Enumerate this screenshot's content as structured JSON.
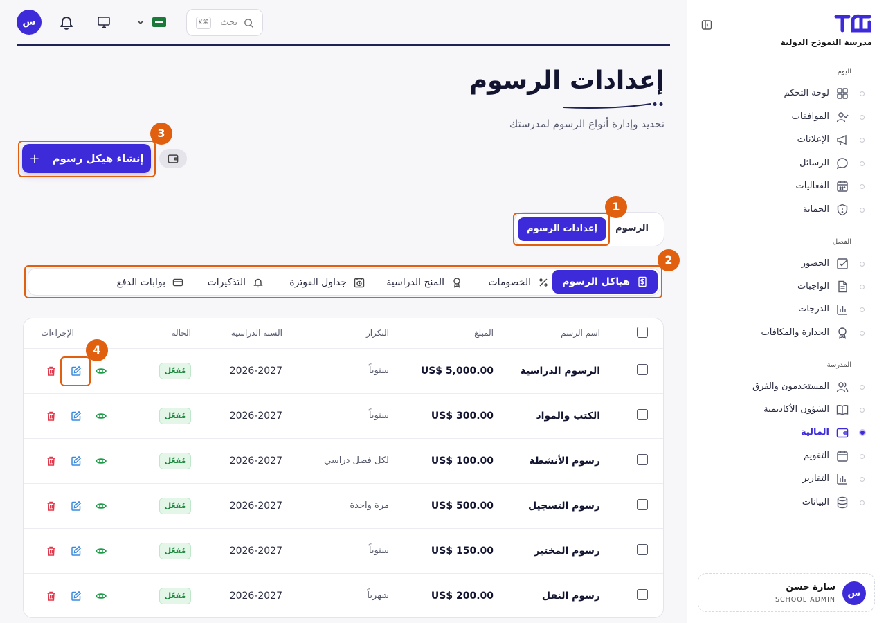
{
  "app": {
    "school_name": "مدرسة النموذج الدولية",
    "accent_color": "#3d2ad9",
    "annotation_color": "#e1600f"
  },
  "topbar": {
    "avatar_initial": "س",
    "search_placeholder": "بحث",
    "search_shortcut": "K⌘",
    "language_flag": "saudi-flag",
    "icons": [
      "bell-icon",
      "monitor-icon",
      "chevron-down-icon",
      "search-icon"
    ]
  },
  "sidebar": {
    "sections": [
      {
        "label": "اليوم",
        "items": [
          {
            "label": "لوحة التحكم",
            "icon": "dashboard-icon"
          },
          {
            "label": "الموافقات",
            "icon": "user-check-icon"
          },
          {
            "label": "الإعلانات",
            "icon": "megaphone-icon"
          },
          {
            "label": "الرسائل",
            "icon": "chat-icon"
          },
          {
            "label": "الفعاليات",
            "icon": "calendar-icon"
          },
          {
            "label": "الحماية",
            "icon": "shield-icon"
          }
        ]
      },
      {
        "label": "الفصل",
        "items": [
          {
            "label": "الحضور",
            "icon": "check-square-icon"
          },
          {
            "label": "الواجبات",
            "icon": "document-icon"
          },
          {
            "label": "الدرجات",
            "icon": "bar-chart-icon"
          },
          {
            "label": "الجدارة والمكافآت",
            "icon": "award-icon"
          }
        ]
      },
      {
        "label": "المدرسة",
        "items": [
          {
            "label": "المستخدمون والفرق",
            "icon": "users-icon"
          },
          {
            "label": "الشؤون الأكاديمية",
            "icon": "book-icon"
          },
          {
            "label": "المالية",
            "icon": "wallet-icon",
            "active": true
          },
          {
            "label": "التقويم",
            "icon": "calendar-icon"
          },
          {
            "label": "التقارير",
            "icon": "bar-chart-icon"
          },
          {
            "label": "البيانات",
            "icon": "database-icon"
          }
        ]
      }
    ],
    "user": {
      "initial": "س",
      "name": "سارة حسن",
      "role": "SCHOOL ADMIN"
    }
  },
  "page": {
    "title": "إعدادات الرسوم",
    "subtitle": "تحديد وإدارة أنواع الرسوم لمدرستك",
    "create_button": "إنشاء هيكل رسوم",
    "create_button_icon": "+"
  },
  "main_tabs": [
    {
      "label": "إعدادات الرسوم",
      "active": true
    },
    {
      "label": "الرسوم",
      "active": false
    }
  ],
  "sub_tabs": [
    {
      "label": "هياكل الرسوم",
      "icon": "dollar-doc-icon",
      "active": true
    },
    {
      "label": "الخصومات",
      "icon": "percent-icon"
    },
    {
      "label": "المنح الدراسية",
      "icon": "award-icon"
    },
    {
      "label": "جداول الفوترة",
      "icon": "calendar-clock-icon"
    },
    {
      "label": "التذكيرات",
      "icon": "bell-icon"
    },
    {
      "label": "بوابات الدفع",
      "icon": "credit-card-icon"
    }
  ],
  "table": {
    "headers": {
      "name": "اسم الرسم",
      "amount": "المبلغ",
      "frequency": "التكرار",
      "year": "السنة الدراسية",
      "status": "الحالة",
      "actions": "الإجراءات"
    },
    "rows": [
      {
        "name": "الرسوم الدراسية",
        "amount": "US$ 5,000.00",
        "frequency": "سنوياً",
        "year": "2026-2027",
        "status": "مُفعّل"
      },
      {
        "name": "الكتب والمواد",
        "amount": "US$ 300.00",
        "frequency": "سنوياً",
        "year": "2026-2027",
        "status": "مُفعّل"
      },
      {
        "name": "رسوم الأنشطة",
        "amount": "US$ 100.00",
        "frequency": "لكل فصل دراسي",
        "year": "2026-2027",
        "status": "مُفعّل"
      },
      {
        "name": "رسوم التسجيل",
        "amount": "US$ 500.00",
        "frequency": "مرة واحدة",
        "year": "2026-2027",
        "status": "مُفعّل"
      },
      {
        "name": "رسوم المختبر",
        "amount": "US$ 150.00",
        "frequency": "سنوياً",
        "year": "2026-2027",
        "status": "مُفعّل"
      },
      {
        "name": "رسوم النقل",
        "amount": "US$ 200.00",
        "frequency": "شهرياً",
        "year": "2026-2027",
        "status": "مُفعّل"
      }
    ]
  },
  "annotations": [
    "1",
    "2",
    "3",
    "4"
  ]
}
